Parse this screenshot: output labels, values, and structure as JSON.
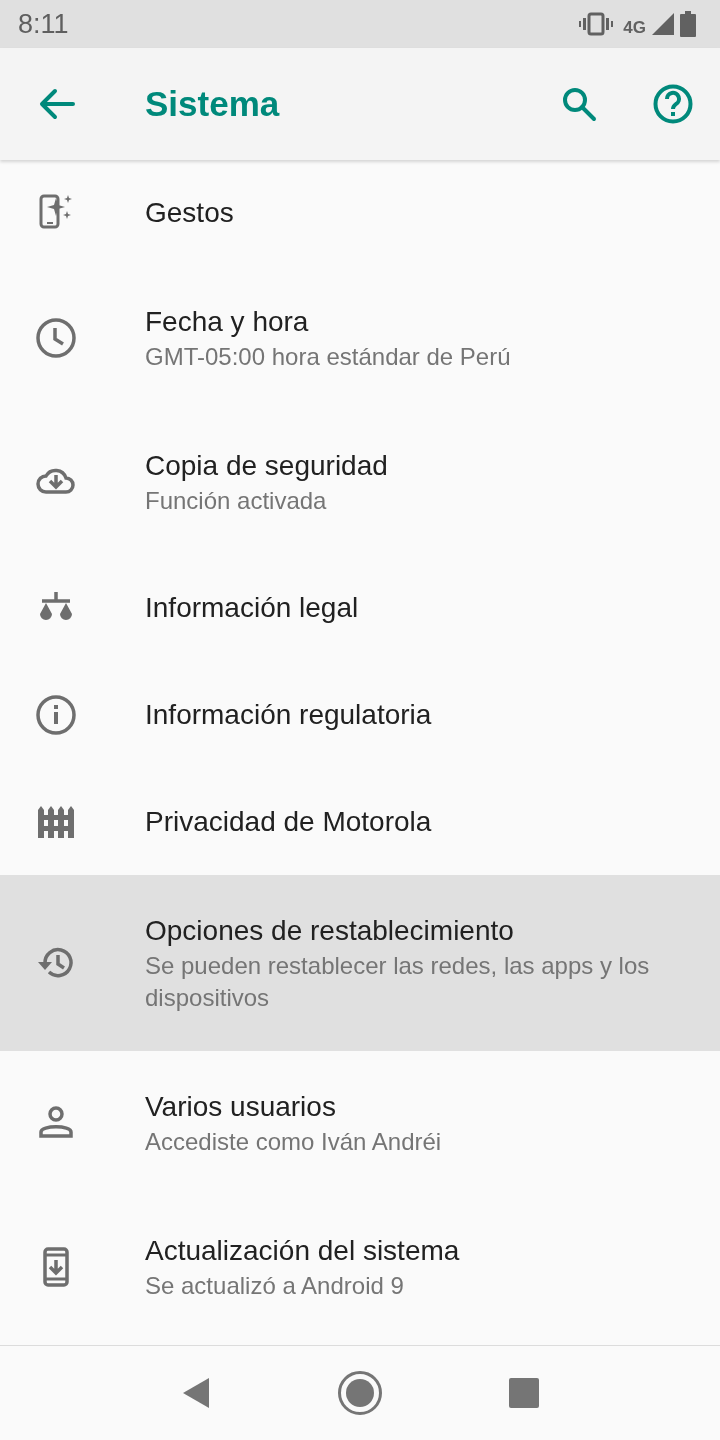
{
  "status_bar": {
    "time": "8:11",
    "network": "4G"
  },
  "app_bar": {
    "title": "Sistema"
  },
  "items": [
    {
      "title": "Gestos",
      "selected": false
    },
    {
      "title": "Fecha y hora",
      "subtitle": "GMT-05:00 hora estándar de Perú",
      "selected": false
    },
    {
      "title": "Copia de seguridad",
      "subtitle": "Función activada",
      "selected": false
    },
    {
      "title": "Información legal",
      "selected": false
    },
    {
      "title": "Información regulatoria",
      "selected": false
    },
    {
      "title": "Privacidad de Motorola",
      "selected": false
    },
    {
      "title": "Opciones de restablecimiento",
      "subtitle": "Se pueden restablecer las redes, las apps y los dispositivos",
      "selected": true
    },
    {
      "title": "Varios usuarios",
      "subtitle": "Accediste como Iván Andréi",
      "selected": false
    },
    {
      "title": "Actualización del sistema",
      "subtitle": "Se actualizó a Android 9",
      "selected": false
    }
  ]
}
